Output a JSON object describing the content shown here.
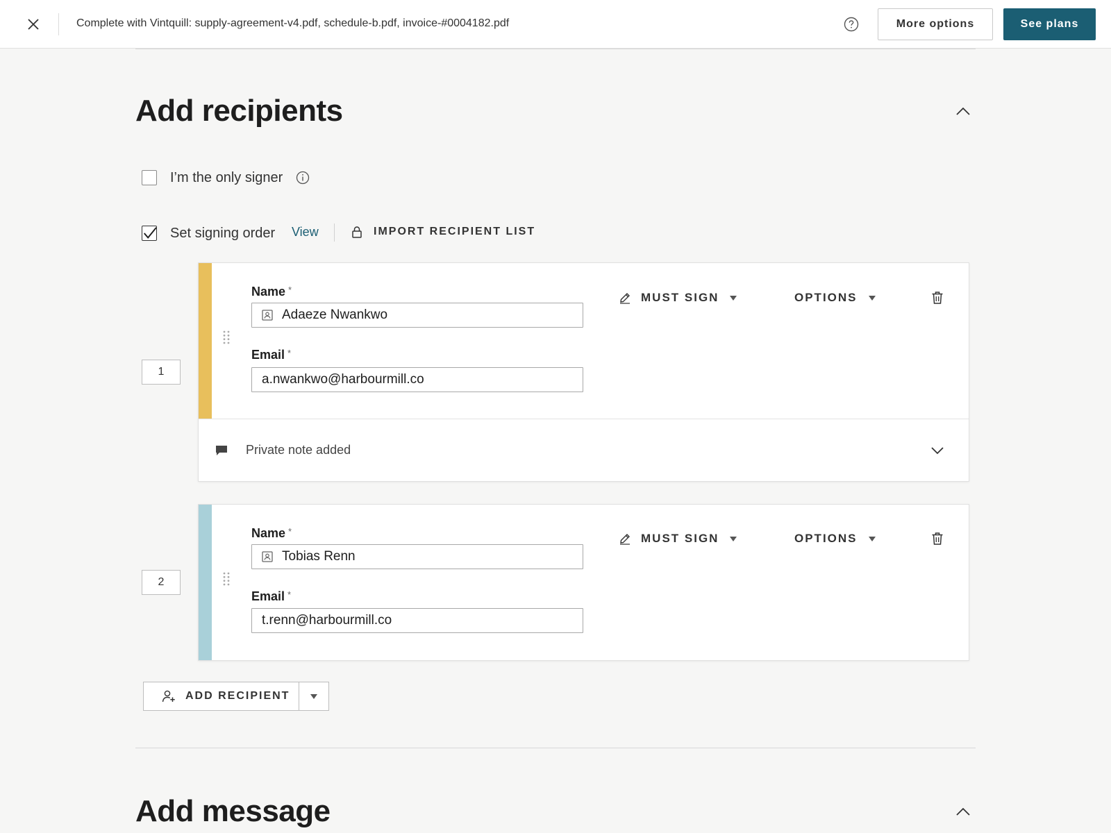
{
  "topbar": {
    "title": "Complete with Vintquill: supply-agreement-v4.pdf, schedule-b.pdf, invoice-#0004182.pdf",
    "more_options_label": "More options",
    "see_plans_label": "See plans"
  },
  "recipients_section": {
    "title": "Add recipients",
    "only_signer_label": "I’m the only signer",
    "only_signer_checked": false,
    "signing_order_label": "Set signing order",
    "signing_order_checked": true,
    "view_link": "View",
    "import_label": "IMPORT RECIPIENT LIST",
    "recipients": [
      {
        "order": "1",
        "stripe_color": "#e8bf5c",
        "name_label": "Name",
        "name_value": "Adaeze Nwankwo",
        "email_label": "Email",
        "email_value": "a.nwankwo@harbourmill.co",
        "role_label": "MUST SIGN",
        "options_label": "OPTIONS",
        "note_text": "Private note added"
      },
      {
        "order": "2",
        "stripe_color": "#a9d0d9",
        "name_label": "Name",
        "name_value": "Tobias Renn",
        "email_label": "Email",
        "email_value": "t.renn@harbourmill.co",
        "role_label": "MUST SIGN",
        "options_label": "OPTIONS"
      }
    ],
    "required_marker": "*",
    "add_recipient_label": "ADD RECIPIENT"
  },
  "message_section": {
    "title": "Add message"
  },
  "colors": {
    "brand": "#1b5e73"
  }
}
